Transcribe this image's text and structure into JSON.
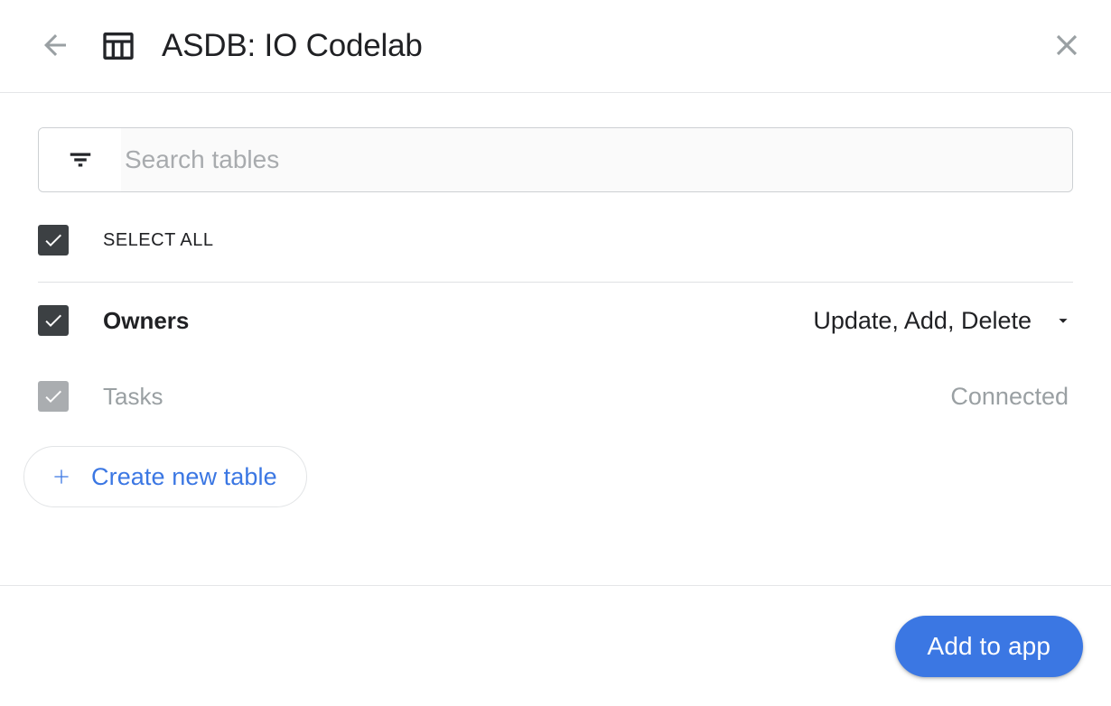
{
  "header": {
    "back_icon": "arrow-left-icon",
    "app_icon": "table-icon",
    "title": "ASDB: IO Codelab",
    "close_icon": "close-icon"
  },
  "search": {
    "filter_icon": "filter-list-icon",
    "placeholder": "Search tables",
    "value": ""
  },
  "select_all": {
    "label": "SELECT ALL",
    "checked": true
  },
  "tables": [
    {
      "name": "Owners",
      "checked": true,
      "disabled": false,
      "action_label": "Update, Add, Delete",
      "action_icon": "chevron-down-icon"
    },
    {
      "name": "Tasks",
      "checked": true,
      "disabled": true,
      "status_label": "Connected"
    }
  ],
  "create_table_button": {
    "plus_icon": "plus-icon",
    "label": "Create new table"
  },
  "footer": {
    "primary_label": "Add to app"
  },
  "colors": {
    "accent": "#3b77e3",
    "checkbox_checked": "#3c4043",
    "checkbox_disabled": "#aaadb0",
    "text_primary": "#202124",
    "text_muted": "#9aa0a3",
    "divider": "#e4e6e8"
  }
}
